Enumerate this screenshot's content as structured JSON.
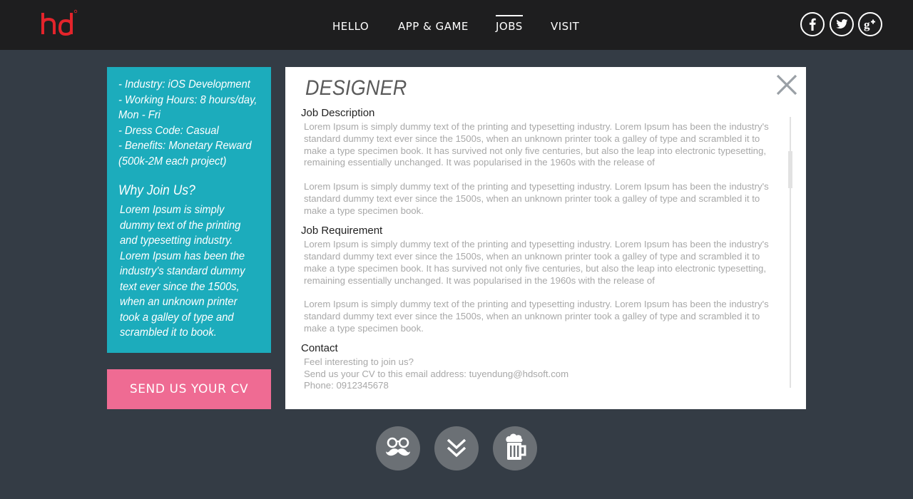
{
  "header": {
    "nav": [
      {
        "label": "HELLO",
        "active": false
      },
      {
        "label": "APP & GAME",
        "active": false
      },
      {
        "label": "JOBS",
        "active": true
      },
      {
        "label": "VISIT",
        "active": false
      }
    ],
    "social_icons": [
      "facebook-icon",
      "twitter-icon",
      "google-plus-icon"
    ],
    "brand_color": "#e3242b"
  },
  "sidebar": {
    "info": [
      "- Industry: iOS Development",
      "- Working Hours: 8 hours/day, Mon - Fri",
      "- Dress Code: Casual",
      "- Benefits: Monetary Reward (500k-2M each project)"
    ],
    "why_title": "Why Join Us?",
    "why_text": "Lorem Ipsum is simply dummy text of the printing and typesetting industry. Lorem Ipsum has been the industry's standard dummy text ever since the 1500s, when an unknown printer took a galley of type and scrambled it to book.",
    "cv_button": "SEND US YOUR CV",
    "panel_color": "#1cacbc",
    "button_color": "#ef6b93"
  },
  "job": {
    "title": "DESIGNER",
    "description": {
      "heading": "Job Description",
      "para1": "Lorem Ipsum is simply dummy text of the printing and typesetting industry. Lorem Ipsum has been the industry's standard dummy text ever since the 1500s, when an unknown printer took a galley of type and scrambled it to make a type specimen book. It has survived not only five centuries, but also the leap into electronic typesetting, remaining essentially unchanged. It was popularised in the 1960s with the release of",
      "para2": "Lorem Ipsum is simply dummy text of the printing and typesetting industry. Lorem Ipsum has been the industry's standard dummy text ever since the 1500s, when an unknown printer took a galley of type and scrambled it to make a type specimen book."
    },
    "requirement": {
      "heading": "Job Requirement",
      "para1": "Lorem Ipsum is simply dummy text of the printing and typesetting industry. Lorem Ipsum has been the industry's standard dummy text ever since the 1500s, when an unknown printer took a galley of type and scrambled it to make a type specimen book. It has survived not only five centuries, but also the leap into electronic typesetting, remaining essentially unchanged. It was popularised in the 1960s with the release of",
      "para2": "Lorem Ipsum is simply dummy text of the printing and typesetting industry. Lorem Ipsum has been the industry's standard dummy text ever since the 1500s, when an unknown printer took a galley of type and scrambled it to make a type specimen book."
    },
    "contact": {
      "heading": "Contact",
      "lines": [
        "Feel interesting to join us?",
        "Send us your CV to this email address: tuyendung@hdsoft.com",
        "Phone: 0912345678"
      ]
    }
  },
  "bottom_buttons": [
    "mustache-glasses-icon",
    "double-chevron-down-icon",
    "beer-mug-icon"
  ]
}
